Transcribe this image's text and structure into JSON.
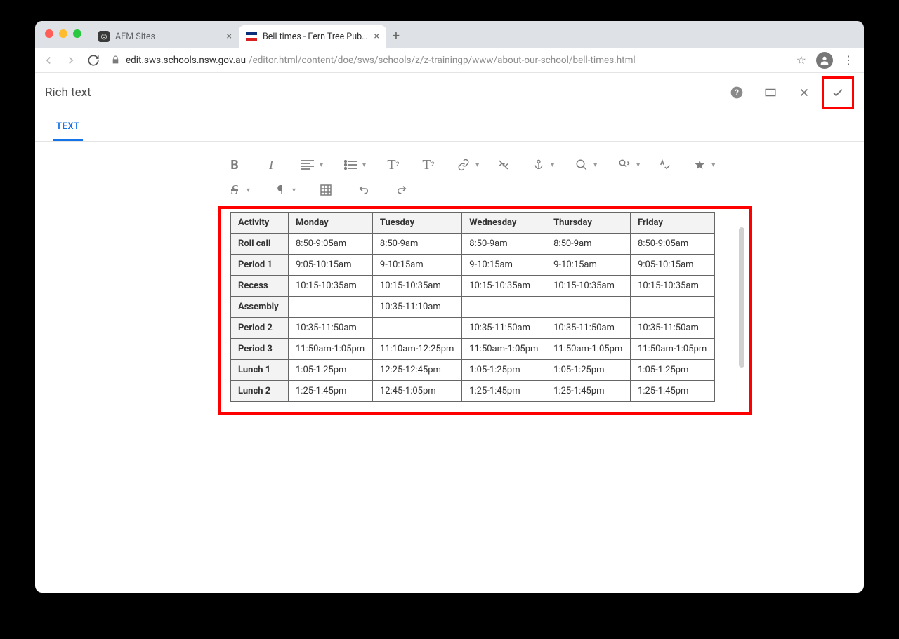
{
  "browser": {
    "tabs": [
      {
        "title": "AEM Sites",
        "active": false
      },
      {
        "title": "Bell times - Fern Tree Public Sc",
        "active": true
      }
    ],
    "url_domain": "edit.sws.schools.nsw.gov.au",
    "url_path": "/editor.html/content/doe/sws/schools/z/z-trainingp/www/about-our-school/bell-times.html"
  },
  "dialog": {
    "title": "Rich text",
    "tab_label": "TEXT"
  },
  "toolbar": {
    "bold": "B",
    "italic": "I",
    "sub": "T",
    "sup": "T",
    "strike": "S"
  },
  "table": {
    "headers": [
      "Activity",
      "Monday",
      "Tuesday",
      "Wednesday",
      "Thursday",
      "Friday"
    ],
    "rows": [
      {
        "activity": "Roll call",
        "cells": [
          "8:50-9:05am",
          "8:50-9am",
          "8:50-9am",
          "8:50-9am",
          "8:50-9:05am"
        ]
      },
      {
        "activity": "Period 1",
        "cells": [
          "9:05-10:15am",
          "9-10:15am",
          "9-10:15am",
          "9-10:15am",
          "9:05-10:15am"
        ]
      },
      {
        "activity": "Recess",
        "cells": [
          "10:15-10:35am",
          "10:15-10:35am",
          "10:15-10:35am",
          "10:15-10:35am",
          "10:15-10:35am"
        ]
      },
      {
        "activity": "Assembly",
        "cells": [
          "",
          "10:35-11:10am",
          "",
          "",
          ""
        ]
      },
      {
        "activity": "Period 2",
        "cells": [
          "10:35-11:50am",
          "",
          "10:35-11:50am",
          "10:35-11:50am",
          "10:35-11:50am"
        ]
      },
      {
        "activity": "Period 3",
        "cells": [
          "11:50am-1:05pm",
          "11:10am-12:25pm",
          "11:50am-1:05pm",
          "11:50am-1:05pm",
          "11:50am-1:05pm"
        ]
      },
      {
        "activity": "Lunch 1",
        "cells": [
          "1:05-1:25pm",
          "12:25-12:45pm",
          "1:05-1:25pm",
          "1:05-1:25pm",
          "1:05-1:25pm"
        ]
      },
      {
        "activity": "Lunch 2",
        "cells": [
          "1:25-1:45pm",
          "12:45-1:05pm",
          "1:25-1:45pm",
          "1:25-1:45pm",
          "1:25-1:45pm"
        ]
      }
    ]
  }
}
